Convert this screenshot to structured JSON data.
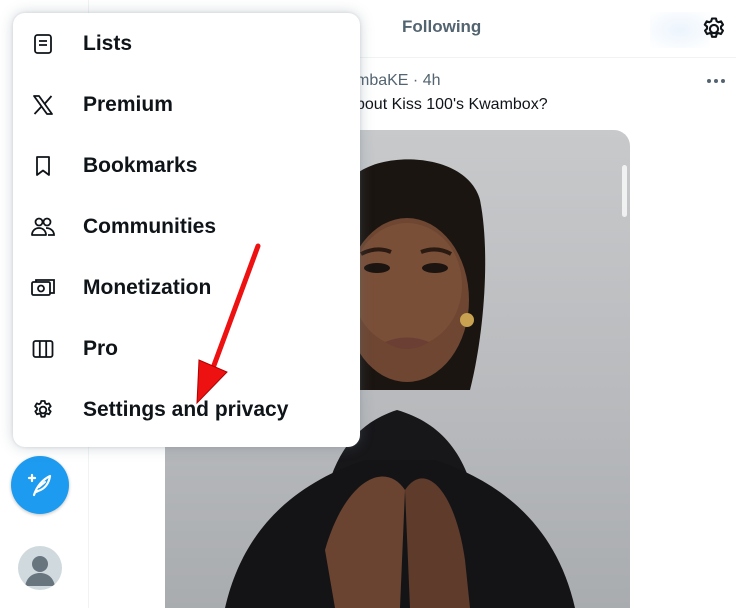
{
  "header": {
    "following_tab": "Following"
  },
  "tweet": {
    "meta": "mbaKE · 4h",
    "text": "bout Kiss 100's Kwambox?"
  },
  "menu": {
    "items": [
      {
        "label": "Lists",
        "icon": "list-icon"
      },
      {
        "label": "Premium",
        "icon": "x-logo-icon"
      },
      {
        "label": "Bookmarks",
        "icon": "bookmark-icon"
      },
      {
        "label": "Communities",
        "icon": "communities-icon"
      },
      {
        "label": "Monetization",
        "icon": "monetization-icon"
      },
      {
        "label": "Pro",
        "icon": "columns-icon"
      },
      {
        "label": "Settings and privacy",
        "icon": "gear-icon"
      }
    ]
  },
  "colors": {
    "accent": "#1d9bf0",
    "text_primary": "#0f1419",
    "text_secondary": "#536471",
    "annotation_arrow": "#ee1111"
  }
}
